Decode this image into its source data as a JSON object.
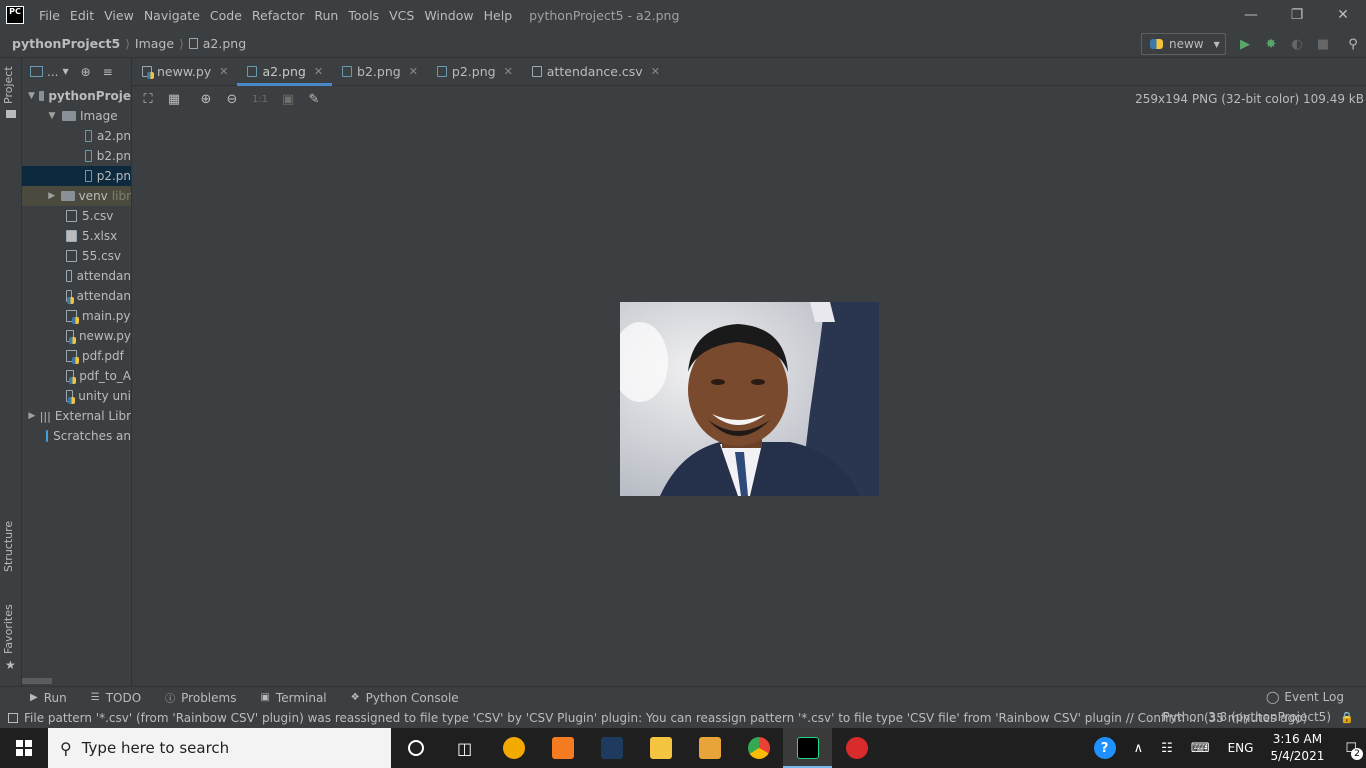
{
  "window": {
    "title": "pythonProject5 - a2.png",
    "app_badge": "PC"
  },
  "menu": [
    "File",
    "Edit",
    "View",
    "Navigate",
    "Code",
    "Refactor",
    "Run",
    "Tools",
    "VCS",
    "Window",
    "Help"
  ],
  "breadcrumb": {
    "project": "pythonProject5",
    "folder": "Image",
    "file": "a2.png"
  },
  "run_config": {
    "label": "neww"
  },
  "left_stripe": {
    "project": "Project",
    "structure": "Structure",
    "favorites": "Favorites"
  },
  "project_panel": {
    "toolbar_menu": "...",
    "root": "pythonProje",
    "folder_image": "Image",
    "files_image": [
      "a2.pn",
      "b2.pn",
      "p2.pn"
    ],
    "venv": "venv",
    "venv_hint": "libr",
    "files": [
      "5.csv",
      "5.xlsx",
      "55.csv",
      "attendan",
      "attendan",
      "main.py",
      "neww.py",
      "pdf.pdf",
      "pdf_to_A",
      "unity uni"
    ],
    "external": "External Libr",
    "scratches": "Scratches an"
  },
  "tabs": [
    "neww.py",
    "a2.png",
    "b2.png",
    "p2.png",
    "attendance.csv"
  ],
  "image_editor": {
    "zoom_label": "1:1",
    "info": "259x194 PNG (32-bit color) 109.49 kB"
  },
  "tool_windows": {
    "run": "Run",
    "todo": "TODO",
    "problems": "Problems",
    "terminal": "Terminal",
    "python_console": "Python Console",
    "event_log": "Event Log"
  },
  "status": {
    "message": "File pattern '*.csv' (from 'Rainbow CSV' plugin) was reassigned to file type 'CSV' by 'CSV Plugin' plugin: You can reassign pattern '*.csv' to file type 'CSV file' from 'Rainbow CSV' plugin // Confirm ... (35 minutes ago)",
    "interpreter": "Python 3.8 (pythonProject5)"
  },
  "taskbar": {
    "search_placeholder": "Type here to search",
    "language": "ENG",
    "time": "3:16 AM",
    "date": "5/4/2021",
    "notifications": "2"
  },
  "colors": {
    "accent": "#4a88c7",
    "background": "#3c3f41",
    "selection": "#0d293e"
  }
}
